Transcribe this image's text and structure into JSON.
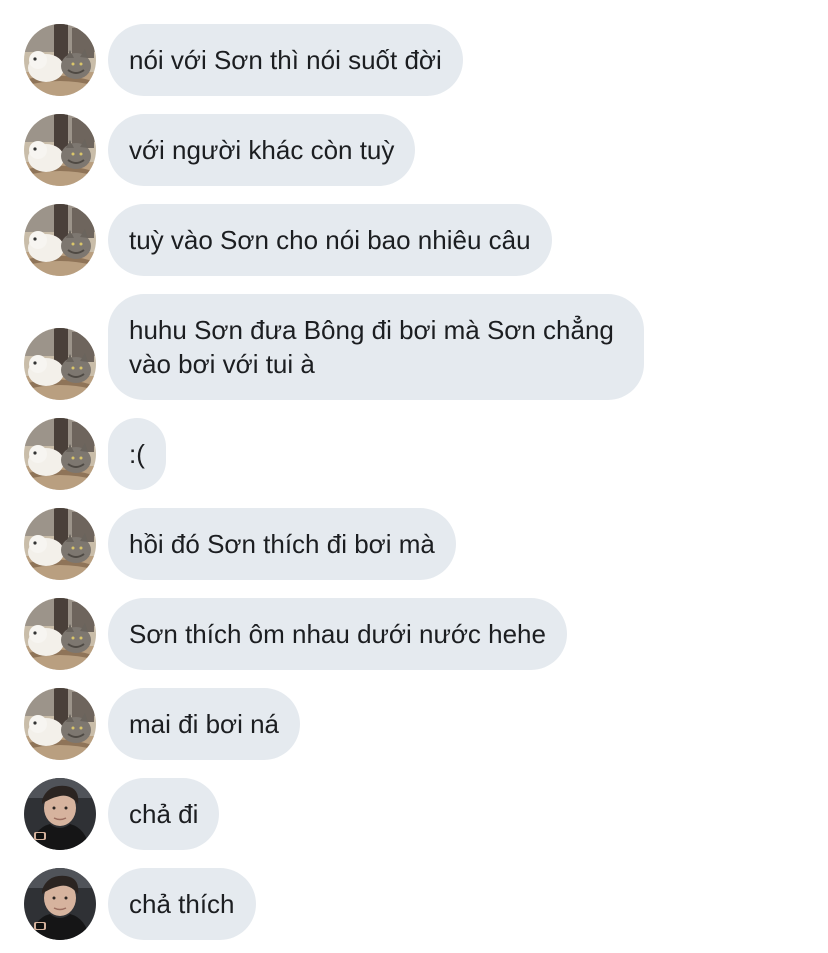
{
  "conversation": {
    "messages": [
      {
        "sender": "cat-dog-avatar",
        "text": "nói với Sơn thì nói suốt đời"
      },
      {
        "sender": "cat-dog-avatar",
        "text": "với người khác còn tuỳ"
      },
      {
        "sender": "cat-dog-avatar",
        "text": "tuỳ vào Sơn cho nói bao nhiêu câu"
      },
      {
        "sender": "cat-dog-avatar",
        "text": "huhu Sơn đưa Bông đi bơi mà Sơn chẳng vào bơi với tui à"
      },
      {
        "sender": "cat-dog-avatar",
        "text": ":("
      },
      {
        "sender": "cat-dog-avatar",
        "text": "hồi đó Sơn thích đi bơi mà"
      },
      {
        "sender": "cat-dog-avatar",
        "text": "Sơn thích ôm nhau dưới nước hehe"
      },
      {
        "sender": "cat-dog-avatar",
        "text": "mai đi bơi ná"
      },
      {
        "sender": "man-avatar",
        "text": "chả đi"
      },
      {
        "sender": "man-avatar",
        "text": "chả thích"
      }
    ]
  },
  "colors": {
    "bubble_bg": "#e5eaef",
    "text": "#1c1e21",
    "background": "#ffffff"
  }
}
